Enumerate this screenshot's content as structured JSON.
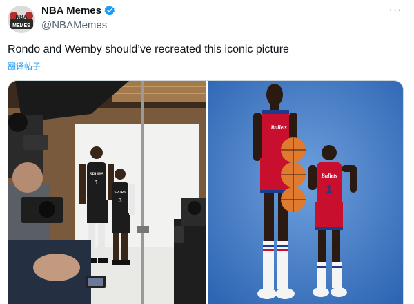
{
  "tweet": {
    "author_name": "NBA Memes",
    "handle": "@NBAMemes",
    "text": "Rondo and Wemby should’ve recreated this iconic picture",
    "translate_label": "翻译帖子",
    "avatar_text_top": "NBA",
    "avatar_text_bottom": "MEMES"
  },
  "media": {
    "left_photo": {
      "jersey_text_1": "SPURS",
      "jersey_number_1": "1",
      "jersey_text_2": "SPURS",
      "jersey_number_2": "3"
    },
    "right_photo": {
      "jersey_text_1": "Bullets",
      "jersey_text_2": "Bullets",
      "jersey_number_2": "1"
    }
  },
  "colors": {
    "verified": "#1d9bf0",
    "link": "#1d9bf0",
    "bullets_red": "#c8102e",
    "backdrop_blue": "#3a78c6"
  }
}
